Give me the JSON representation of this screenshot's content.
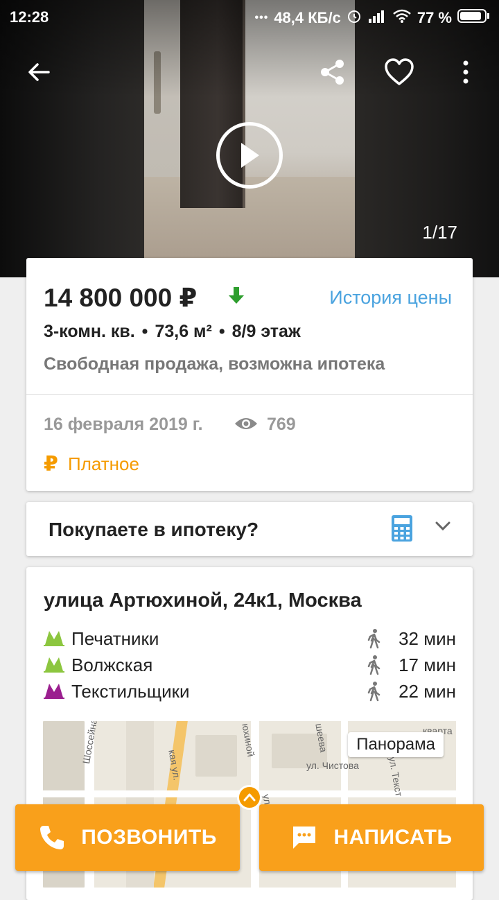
{
  "status_bar": {
    "time": "12:28",
    "network_speed": "48,4 КБ/с",
    "battery": "77 %",
    "dots": "•••"
  },
  "gallery": {
    "counter": "1/17"
  },
  "listing": {
    "price": "14 800 000 ₽",
    "price_history_link": "История цены",
    "rooms": "3-комн. кв.",
    "area": "73,6 м²",
    "floor": "8/9 этаж",
    "separator": "•",
    "sale_type": "Свободная продажа, возможна ипотека",
    "date": "16 февраля 2019 г.",
    "views": "769",
    "paid_symbol": "₽",
    "paid_label": "Платное"
  },
  "mortgage": {
    "question": "Покупаете в ипотеку?"
  },
  "location": {
    "address": "улица Артюхиной, 24к1, Москва",
    "metro": [
      {
        "station": "Печатники",
        "minutes": "32 мин",
        "line_color": "#8cc63f"
      },
      {
        "station": "Волжская",
        "minutes": "17 мин",
        "line_color": "#8cc63f"
      },
      {
        "station": "Текстильщики",
        "minutes": "22 мин",
        "line_color": "#9b1f8f"
      }
    ],
    "map": {
      "panorama_label": "Панорама",
      "street_labels": [
        "Шоссейная у",
        "кая ул.",
        "юхиной",
        "шеева",
        "ул. Чистова",
        "ул. Текст",
        "кварта",
        "ул. А"
      ]
    }
  },
  "actions": {
    "call": "ПОЗВОНИТЬ",
    "message": "НАПИСАТЬ"
  },
  "colors": {
    "accent_orange": "#f9a01b",
    "link_blue": "#4aa3df",
    "price_down_green": "#2e9e2e"
  }
}
